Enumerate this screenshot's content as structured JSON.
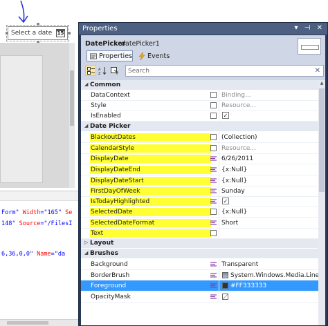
{
  "designer": {
    "datepicker_placeholder": "Select a date",
    "calendar_day": "15",
    "xaml_lines": [
      {
        "parts": [
          {
            "t": "Form\"",
            "c": "x-val"
          },
          {
            "t": " Width",
            "c": "x-attr"
          },
          {
            "t": "=\"165\"",
            "c": "x-val"
          },
          {
            "t": " Se",
            "c": "x-attr"
          }
        ]
      },
      {
        "parts": [
          {
            "t": "148\"",
            "c": "x-val"
          },
          {
            "t": " Source",
            "c": "x-attr"
          },
          {
            "t": "=\"/FilesI",
            "c": "x-val"
          }
        ]
      },
      {
        "parts": [
          {
            "t": "6,36,0,0\"",
            "c": "x-val"
          },
          {
            "t": " Name",
            "c": "x-attr"
          },
          {
            "t": "=\"da",
            "c": "x-val"
          }
        ]
      }
    ]
  },
  "properties": {
    "window_title": "Properties",
    "title_icons": "▾ ⊣ ✕",
    "object_type": "DatePicker",
    "object_name": "datePicker1",
    "tabs": {
      "properties": "Properties",
      "events": "Events"
    },
    "search_placeholder": "Search",
    "search_clear": "✕",
    "categories": {
      "common": "Common",
      "date_picker": "Date Picker",
      "layout": "Layout",
      "brushes": "Brushes"
    },
    "rows": [
      {
        "name": "DataContext",
        "value": "Binding...",
        "dim": true
      },
      {
        "name": "Style",
        "value": "Resource...",
        "dim": true
      },
      {
        "name": "IsEnabled",
        "value": "✓",
        "kind": "check"
      },
      {
        "name": "BlackoutDates",
        "value": "(Collection)"
      },
      {
        "name": "CalendarStyle",
        "value": "Resource...",
        "dim": true
      },
      {
        "name": "DisplayDate",
        "value": "6/26/2011"
      },
      {
        "name": "DisplayDateEnd",
        "value": "{x:Null}"
      },
      {
        "name": "DisplayDateStart",
        "value": "{x:Null}"
      },
      {
        "name": "FirstDayOfWeek",
        "value": "Sunday"
      },
      {
        "name": "IsTodayHighlighted",
        "value": "✓",
        "kind": "check"
      },
      {
        "name": "SelectedDate",
        "value": "{x:Null}"
      },
      {
        "name": "SelectedDateFormat",
        "value": "Short"
      },
      {
        "name": "Text",
        "value": ""
      },
      {
        "name": "Background",
        "value": "Transparent"
      },
      {
        "name": "BorderBrush",
        "value": "System.Windows.Media.Linea"
      },
      {
        "name": "Foreground",
        "value": "#FF333333"
      },
      {
        "name": "OpacityMask",
        "value": ""
      }
    ]
  },
  "colors": {
    "highlight": "#ffff33",
    "selection": "#3399ff",
    "title_bar": "#4d6082",
    "foreground_swatch": "#333333"
  }
}
